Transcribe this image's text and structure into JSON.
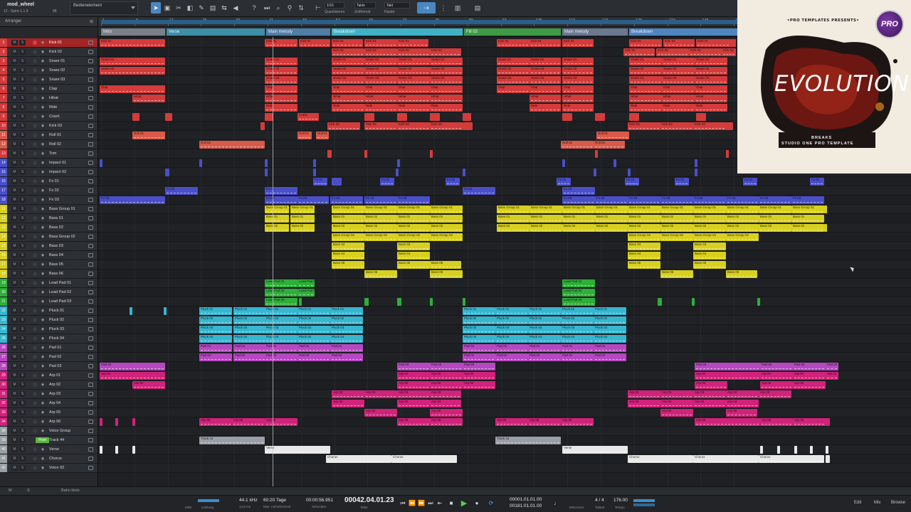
{
  "toolbar": {
    "song_name": "mod_wheel",
    "song_sub": "12 - Spire-1.1.9",
    "song_num": "88",
    "control_label": "Bedienelement",
    "quant_label": "Quantisieren",
    "quant_value": "1/16",
    "timebase_label": "Zeitformat",
    "timebase_value": "Takte",
    "snap_label": "Raster",
    "snap_value": "Takt"
  },
  "arranger": {
    "header_label": "Arranger",
    "bars": [
      "1",
      "9",
      "17",
      "25",
      "33",
      "41",
      "49",
      "57",
      "65",
      "73",
      "81",
      "89",
      "97",
      "105",
      "113",
      "121",
      "129",
      "137",
      "145",
      "153"
    ],
    "markers": [
      {
        "label": "Intro",
        "color": "#7a7f88"
      },
      {
        "label": "Verse",
        "color": "#3d8ea6"
      },
      {
        "label": "Main melody",
        "color": "#4f7ea6"
      },
      {
        "label": "Breakdown",
        "color": "#3fb2c8"
      },
      {
        "label": "Fill 02",
        "color": "#3f9a45"
      },
      {
        "label": "Main melody",
        "color": "#6a7890"
      },
      {
        "label": "Breakdown",
        "color": "#4f86c0"
      }
    ]
  },
  "tracks": [
    {
      "num": "1",
      "name": "Kick 01",
      "color": "#d43b3b",
      "sel": true
    },
    {
      "num": "2",
      "name": "Kick 02",
      "color": "#d43b3b"
    },
    {
      "num": "3",
      "name": "Snare 01",
      "color": "#d43b3b"
    },
    {
      "num": "4",
      "name": "Snare 02",
      "color": "#d43b3b"
    },
    {
      "num": "5",
      "name": "Snare 03",
      "color": "#d43b3b"
    },
    {
      "num": "6",
      "name": "Clap",
      "color": "#d43b3b"
    },
    {
      "num": "7",
      "name": "Hihat",
      "color": "#d43b3b"
    },
    {
      "num": "8",
      "name": "Ride",
      "color": "#d43b3b"
    },
    {
      "num": "9",
      "name": "Crash",
      "color": "#d43b3b"
    },
    {
      "num": "10",
      "name": "Kick 03",
      "color": "#d43b3b"
    },
    {
      "num": "11",
      "name": "Roll 01",
      "color": "#d95a4a"
    },
    {
      "num": "12",
      "name": "Roll 02",
      "color": "#d95a4a"
    },
    {
      "num": "13",
      "name": "Tom",
      "color": "#d43b3b"
    },
    {
      "num": "14",
      "name": "Impact 01",
      "color": "#4a4fc8"
    },
    {
      "num": "15",
      "name": "Impact 02",
      "color": "#4a4fc8"
    },
    {
      "num": "16",
      "name": "Fx 01",
      "color": "#4a4fc8"
    },
    {
      "num": "17",
      "name": "Fx 02",
      "color": "#4a4fc8"
    },
    {
      "num": "18",
      "name": "Fx 03",
      "color": "#4a4fc8"
    },
    {
      "num": "11",
      "name": "Bass Group 01",
      "color": "#d8d020"
    },
    {
      "num": "12",
      "name": "Bass 01",
      "color": "#d8d020"
    },
    {
      "num": "13",
      "name": "Bass 02",
      "color": "#d8d020"
    },
    {
      "num": "14",
      "name": "Bass Group 02",
      "color": "#d8d020"
    },
    {
      "num": "15",
      "name": "Bass 03",
      "color": "#d8d020"
    },
    {
      "num": "16",
      "name": "Bass 04",
      "color": "#d8d020"
    },
    {
      "num": "17",
      "name": "Bass 05",
      "color": "#d8d020"
    },
    {
      "num": "18",
      "name": "Bass 06",
      "color": "#d8d020"
    },
    {
      "num": "19",
      "name": "Lead Pad 01",
      "color": "#2fae3a"
    },
    {
      "num": "20",
      "name": "Lead Pad 02",
      "color": "#2fae3a"
    },
    {
      "num": "21",
      "name": "Lead Pad 03",
      "color": "#2fae3a"
    },
    {
      "num": "22",
      "name": "Pluck 01",
      "color": "#38b6d0"
    },
    {
      "num": "23",
      "name": "Pluck 02",
      "color": "#38b6d0"
    },
    {
      "num": "24",
      "name": "Pluck 03",
      "color": "#38b6d0"
    },
    {
      "num": "25",
      "name": "Pluck 04",
      "color": "#38b6d0"
    },
    {
      "num": "26",
      "name": "Pad 01",
      "color": "#b548c0"
    },
    {
      "num": "27",
      "name": "Pad 02",
      "color": "#b548c0"
    },
    {
      "num": "28",
      "name": "Pad 03",
      "color": "#b548c0"
    },
    {
      "num": "29",
      "name": "Arp 01",
      "color": "#d0237a"
    },
    {
      "num": "30",
      "name": "Arp 02",
      "color": "#d0237a"
    },
    {
      "num": "31",
      "name": "Arp 03",
      "color": "#d0237a"
    },
    {
      "num": "32",
      "name": "Arp 04",
      "color": "#d0237a"
    },
    {
      "num": "33",
      "name": "Arp 05",
      "color": "#d0237a"
    },
    {
      "num": "34",
      "name": "Arp 06",
      "color": "#d0237a"
    },
    {
      "num": "38",
      "name": "Voice Group",
      "color": "#9a9ea5"
    },
    {
      "num": "39",
      "name": "Track 44",
      "color": "#9a9ea5",
      "tag": "Pixel"
    },
    {
      "num": "40",
      "name": "Verse",
      "color": "#9a9ea5"
    },
    {
      "num": "41",
      "name": "Chorus",
      "color": "#9a9ea5"
    },
    {
      "num": "42",
      "name": "Voice 03",
      "color": "#9a9ea5"
    }
  ],
  "cover": {
    "presents": "•PRO TEMPLATES PRESENTS•",
    "logo": "PRO",
    "title": "EVOLUTION",
    "subtitle1": "BREAKS",
    "subtitle2": "STUDIO ONE PRO TEMPLATE"
  },
  "bottom_strip": {
    "left_label": "M",
    "s_label": "S",
    "bottom_label": "Bahn klein"
  },
  "transport": {
    "midi_label": "MIDI",
    "perf_label": "Leistung",
    "sample_rate": "44.1 kHz",
    "latency": "14.8 ms",
    "rec_days": "60:20 Tage",
    "rec_label": "Max. Aufnahmezeit",
    "seconds_value": "00:00:56.951",
    "seconds_label": "Sekunden",
    "bars_value": "00042.04.01.23",
    "bars_label": "Takte",
    "loop_start": "00001.01.01.00",
    "loop_end": "00181.01.01.00",
    "metronome_label": "Metronom",
    "timesig": "4 / 4",
    "timesig_label": "Taktart",
    "tempo": "176.00",
    "tempo_label": "Tempo",
    "edit_label": "Edit",
    "mix_label": "Mix",
    "browse_label": "Browse"
  }
}
